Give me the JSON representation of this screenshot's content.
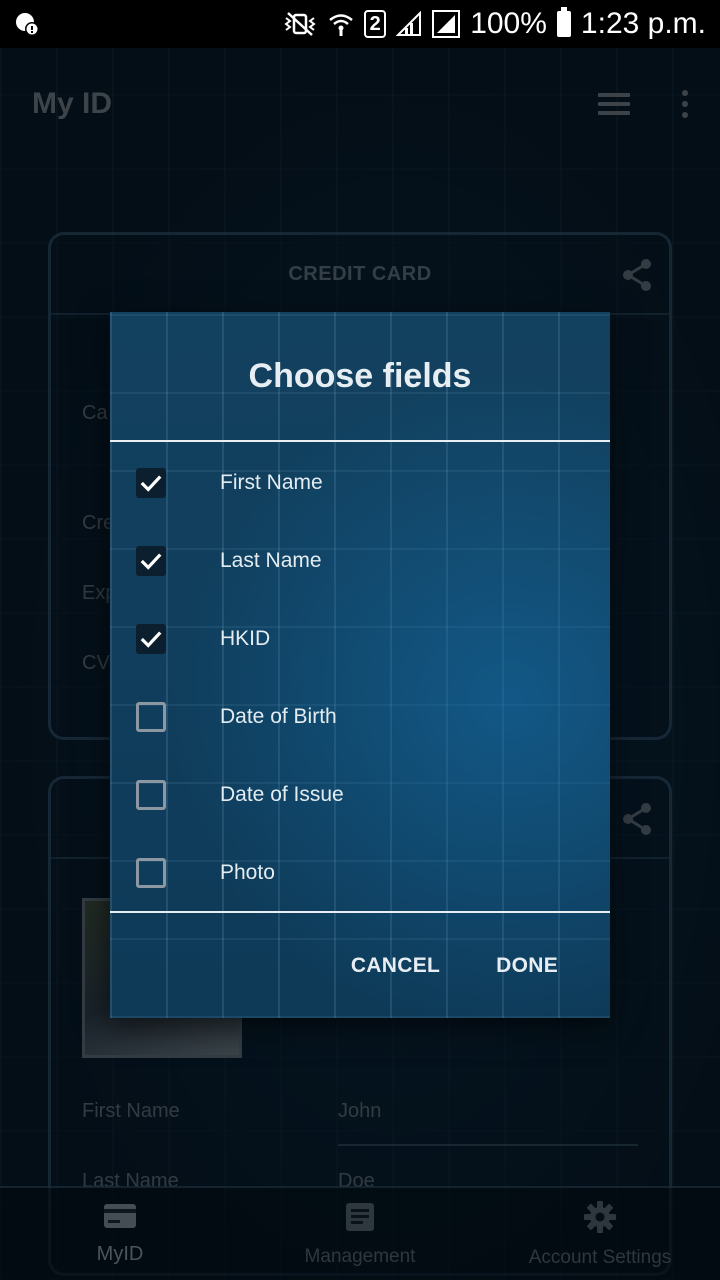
{
  "status_bar": {
    "battery": "100%",
    "time": "1:23 p.m.",
    "sim_badge": "2",
    "icons": [
      "notification-info-icon",
      "vibrate-icon",
      "wifi-icon",
      "signal-icon",
      "signal-icon",
      "battery-icon"
    ]
  },
  "appbar": {
    "title": "My ID",
    "icons": [
      "hamburger-menu-icon",
      "more-vert-icon"
    ]
  },
  "card1": {
    "title": "CREDIT CARD",
    "labels": [
      "Ca",
      "Cre",
      "Exp",
      "CV"
    ]
  },
  "card2": {
    "fields": [
      {
        "label": "First Name",
        "value": "John"
      },
      {
        "label": "Last Name",
        "value": "Doe"
      }
    ]
  },
  "dialog": {
    "title": "Choose fields",
    "options": [
      {
        "label": "First Name",
        "checked": true
      },
      {
        "label": "Last Name",
        "checked": true
      },
      {
        "label": "HKID",
        "checked": true
      },
      {
        "label": "Date of Birth",
        "checked": false
      },
      {
        "label": "Date of Issue",
        "checked": false
      },
      {
        "label": "Photo",
        "checked": false
      }
    ],
    "cancel": "CANCEL",
    "done": "DONE"
  },
  "bottom_nav": {
    "items": [
      {
        "label": "MyID",
        "icon": "card-icon",
        "active": true
      },
      {
        "label": "Management",
        "icon": "document-icon",
        "active": false
      },
      {
        "label": "Account Settings",
        "icon": "gear-icon",
        "active": false
      }
    ]
  },
  "colors": {
    "dialog_bg": "#12415f",
    "text_light": "#e6eef3",
    "muted": "#6d7d88"
  }
}
